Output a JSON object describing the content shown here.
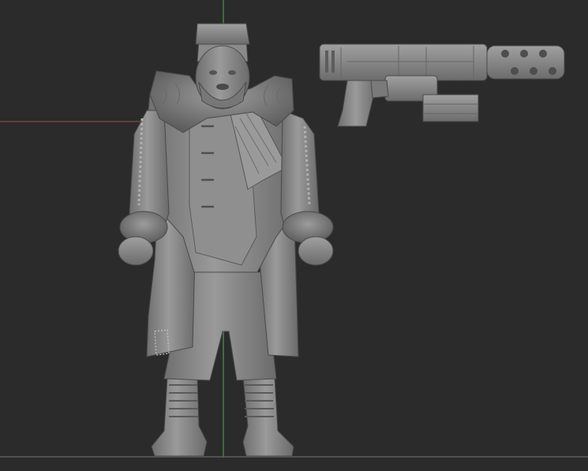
{
  "viewport": {
    "background": "#2b2b2b",
    "axis_y_color": "#3fa23f",
    "axis_x_color": "#a03a3a",
    "floor_color": "#5c5c5c"
  },
  "models": [
    {
      "name": "fur-coat-soldier-figure",
      "material_color": "#8a8a8a"
    },
    {
      "name": "heavy-laser-rifle",
      "material_color": "#8c8c8c"
    }
  ]
}
